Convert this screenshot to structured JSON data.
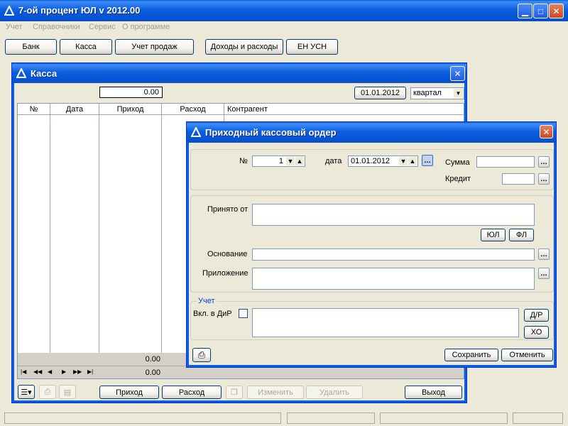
{
  "app": {
    "title": "7-ой процент ЮЛ v 2012.00",
    "menu": [
      "Учет",
      "Справочники",
      "Сервис",
      "О программе"
    ],
    "toolbar": [
      "Банк",
      "Касса",
      "Учет продаж",
      "Доходы и расходы",
      "ЕН УСН"
    ]
  },
  "kassa": {
    "title": "Касса",
    "balance": "0.00",
    "date": "01.01.2012",
    "period": "квартал",
    "columns": [
      "№",
      "Дата",
      "Приход",
      "Расход",
      "Контрагент"
    ],
    "totals": [
      "0.00",
      "0.00"
    ],
    "buttons": {
      "income": "Приход",
      "expense": "Расход",
      "edit": "Изменить",
      "delete": "Удалить",
      "exit": "Выход"
    }
  },
  "dialog": {
    "title": "Приходный кассовый ордер",
    "number_label": "№",
    "number_value": "1",
    "date_label": "дата",
    "date_value": "01.01.2012",
    "sum_label": "Сумма",
    "sum_value": "",
    "credit_label": "Кредит",
    "credit_value": "",
    "received_from_label": "Принято от",
    "received_from_value": "",
    "btn_ul": "ЮЛ",
    "btn_fl": "ФЛ",
    "basis_label": "Основание",
    "basis_value": "",
    "attachment_label": "Приложение",
    "attachment_value": "",
    "accounting_group": "Учет",
    "include_dir_label": "Вкл. в ДиР",
    "btn_dr": "Д/Р",
    "btn_ho": "ХО",
    "save": "Сохранить",
    "cancel": "Отменить"
  },
  "colors": {
    "titlebar": "#0a5fdc",
    "window_bg": "#ece9d8",
    "field_border": "#7f9db9"
  }
}
